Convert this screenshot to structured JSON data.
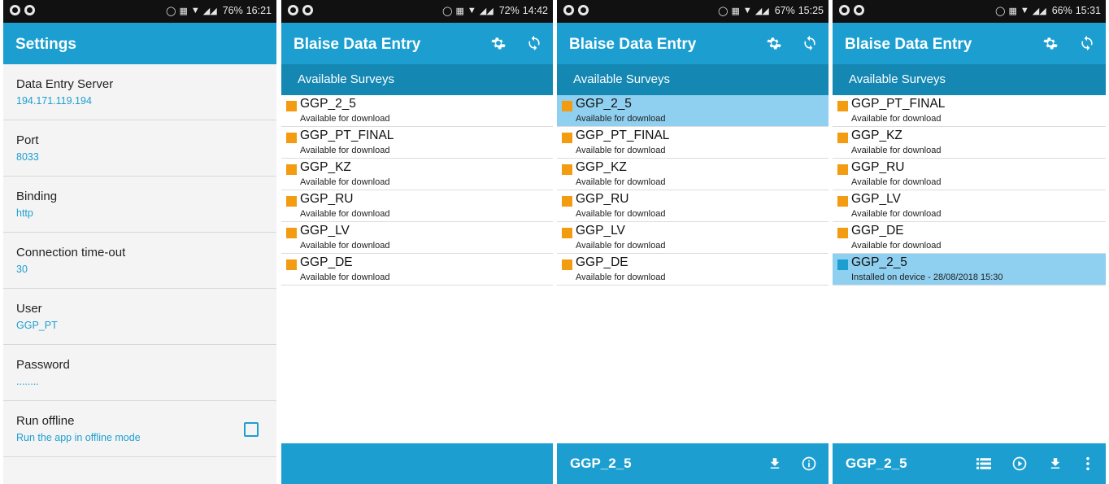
{
  "colors": {
    "primary": "#1c9fd0",
    "primary_dark": "#1487b3",
    "selected_row": "#8fd0f0",
    "not_installed_marker": "#f39c12",
    "installed_marker": "#1c9fd0"
  },
  "screen1": {
    "status": {
      "battery": "76%",
      "time": "16:21"
    },
    "title": "Settings",
    "settings": [
      {
        "label": "Data Entry Server",
        "value": "194.171.119.194"
      },
      {
        "label": "Port",
        "value": "8033"
      },
      {
        "label": "Binding",
        "value": "http"
      },
      {
        "label": "Connection time-out",
        "value": "30"
      },
      {
        "label": "User",
        "value": "GGP_PT"
      },
      {
        "label": "Password",
        "value": "........"
      },
      {
        "label": "Run offline",
        "value": "Run the app in offline mode",
        "checked": false
      }
    ]
  },
  "screen2": {
    "status": {
      "battery": "72%",
      "time": "14:42"
    },
    "title": "Blaise Data Entry",
    "subheader": "Available Surveys",
    "surveys": [
      {
        "name": "GGP_2_5",
        "status": "Available for download"
      },
      {
        "name": "GGP_PT_FINAL",
        "status": "Available for download"
      },
      {
        "name": "GGP_KZ",
        "status": "Available for download"
      },
      {
        "name": "GGP_RU",
        "status": "Available for download"
      },
      {
        "name": "GGP_LV",
        "status": "Available for download"
      },
      {
        "name": "GGP_DE",
        "status": "Available for download"
      }
    ]
  },
  "screen3": {
    "status": {
      "battery": "67%",
      "time": "15:25"
    },
    "title": "Blaise Data Entry",
    "subheader": "Available Surveys",
    "surveys": [
      {
        "name": "GGP_2_5",
        "status": "Available for download"
      },
      {
        "name": "GGP_PT_FINAL",
        "status": "Available for download"
      },
      {
        "name": "GGP_KZ",
        "status": "Available for download"
      },
      {
        "name": "GGP_RU",
        "status": "Available for download"
      },
      {
        "name": "GGP_LV",
        "status": "Available for download"
      },
      {
        "name": "GGP_DE",
        "status": "Available for download"
      }
    ],
    "selected_survey": "GGP_2_5"
  },
  "screen4": {
    "status": {
      "battery": "66%",
      "time": "15:31"
    },
    "title": "Blaise Data Entry",
    "subheader": "Available Surveys",
    "surveys": [
      {
        "name": "GGP_PT_FINAL",
        "status": "Available for download"
      },
      {
        "name": "GGP_KZ",
        "status": "Available for download"
      },
      {
        "name": "GGP_RU",
        "status": "Available for download"
      },
      {
        "name": "GGP_LV",
        "status": "Available for download"
      },
      {
        "name": "GGP_DE",
        "status": "Available for download"
      },
      {
        "name": "GGP_2_5",
        "status": "Installed on device - 28/08/2018 15:30"
      }
    ],
    "selected_survey": "GGP_2_5"
  },
  "icons": {
    "settings": "gear-icon",
    "sync": "sync-icon",
    "download": "download-icon",
    "info": "info-icon",
    "list": "list-icon",
    "play": "play-icon",
    "more": "more-vert-icon"
  }
}
